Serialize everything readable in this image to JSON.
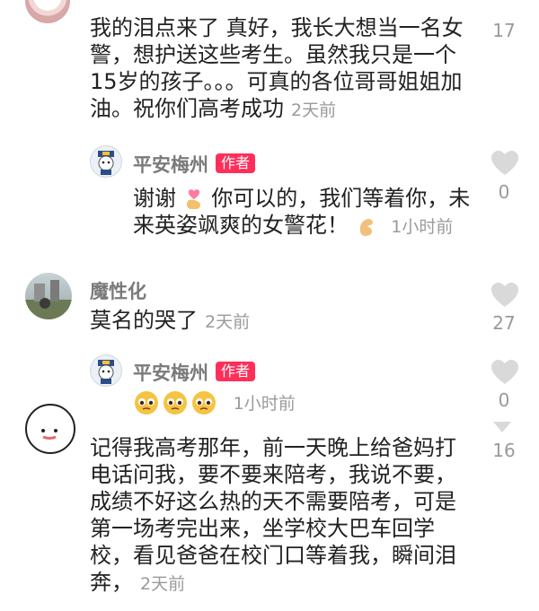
{
  "comments": [
    {
      "text": "我的泪点来了 真好，我长大想当一名女警，想护送这些考生。虽然我只是一个15岁的孩子。。。可真的各位哥哥姐姐加油。祝你们高考成功",
      "time": "2天前",
      "likes": "17",
      "reply": {
        "username": "平安梅州",
        "badge": "作者",
        "text_a": "谢谢",
        "text_b": "你可以的，我们等着你，未来英姿飒爽的女警花！",
        "time": "1小时前",
        "likes": "0"
      }
    },
    {
      "username": "魔性化",
      "text": "莫名的哭了",
      "time": "2天前",
      "likes": "27",
      "reply": {
        "username": "平安梅州",
        "badge": "作者",
        "time": "1小时前",
        "likes": "0"
      }
    },
    {
      "text": "记得我高考那年，前一天晚上给爸妈打电话问我，要不要来陪考，我说不要，成绩不好这么热的天不需要陪考，可是第一场考完出来，坐学校大巴车回学校，看见爸爸在校门口等着我，瞬间泪奔，",
      "time": "2天前",
      "likes": "16"
    }
  ],
  "colors": {
    "badge": "#ff2f5a",
    "heart": "#d9d9d9",
    "muted": "#9a9a9a"
  }
}
